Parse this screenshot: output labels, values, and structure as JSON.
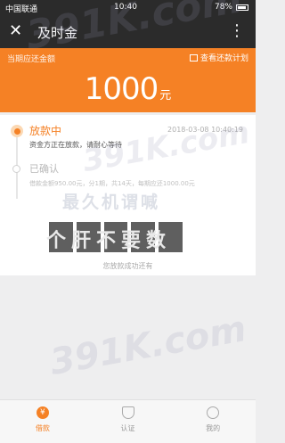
{
  "status_bar": {
    "carrier": "中国联通",
    "time": "10:40",
    "battery": "78%"
  },
  "nav": {
    "close_icon": "close-icon",
    "title": "及时金",
    "more_icon": "more-icon"
  },
  "amount_panel": {
    "label": "当期应还金额",
    "plan_link": "查看还款计划",
    "amount": "1000",
    "unit": "元",
    "color": "#f58125"
  },
  "timeline": {
    "step1": {
      "title": "放款中",
      "time": "2018-03-08 10:40:19",
      "desc": "资金方正在放款，请耐心等待"
    },
    "step2": {
      "title": "已确认",
      "desc": "借款金额950.00元，分1期，共14天，每期应还1000.00元"
    }
  },
  "overlay": {
    "text": "个肝不要数"
  },
  "hint": "您放款成功还有",
  "watermarks": {
    "a": "391K.com",
    "b": "391K.com",
    "c": "391K.com",
    "cn": "最久机谓喊"
  },
  "tabs": [
    {
      "label": "借款",
      "icon": "loan-icon",
      "active": true
    },
    {
      "label": "认证",
      "icon": "shield-icon",
      "active": false
    },
    {
      "label": "我的",
      "icon": "user-icon",
      "active": false
    }
  ]
}
